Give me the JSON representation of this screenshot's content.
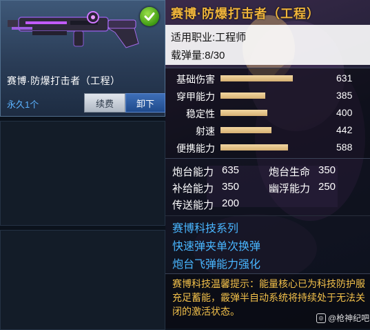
{
  "weapon_card": {
    "name": "赛博·防爆打击者（工程）",
    "duration": "永久1个",
    "renew_label": "续费",
    "unload_label": "卸下"
  },
  "detail": {
    "title": "赛博·防爆打击者（工程）",
    "profession": "适用职业:工程师",
    "ammo": "载弹量:8/30",
    "stats": [
      {
        "label": "基础伤害",
        "value": "631",
        "fill": 0.7
      },
      {
        "label": "穿甲能力",
        "value": "385",
        "fill": 0.43
      },
      {
        "label": "稳定性",
        "value": "400",
        "fill": 0.45
      },
      {
        "label": "射速",
        "value": "442",
        "fill": 0.49
      },
      {
        "label": "便携能力",
        "value": "588",
        "fill": 0.65
      }
    ],
    "turret": {
      "attack_label": "炮台能力",
      "attack_value": "635",
      "life_label": "炮台生命",
      "life_value": "350",
      "supply_label": "补给能力",
      "supply_value": "350",
      "float_label": "幽浮能力",
      "float_value": "250",
      "teleport_label": "传送能力",
      "teleport_value": "200"
    },
    "skills": [
      "赛博科技系列",
      "快速弹夹单次换弹",
      "炮台飞弹能力强化"
    ],
    "tip": "赛博科技温馨提示：能量核心已为科技防护服充足蓄能，霰弹半自动系统将持续处于无法关闭的激活状态。"
  },
  "watermark": "@枪神纪吧",
  "colors": {
    "title": "#f0b53c",
    "skill": "#49b6ff",
    "tip": "#f2c04a",
    "duration": "#5cb3ff",
    "bar": "#e3c48b"
  }
}
